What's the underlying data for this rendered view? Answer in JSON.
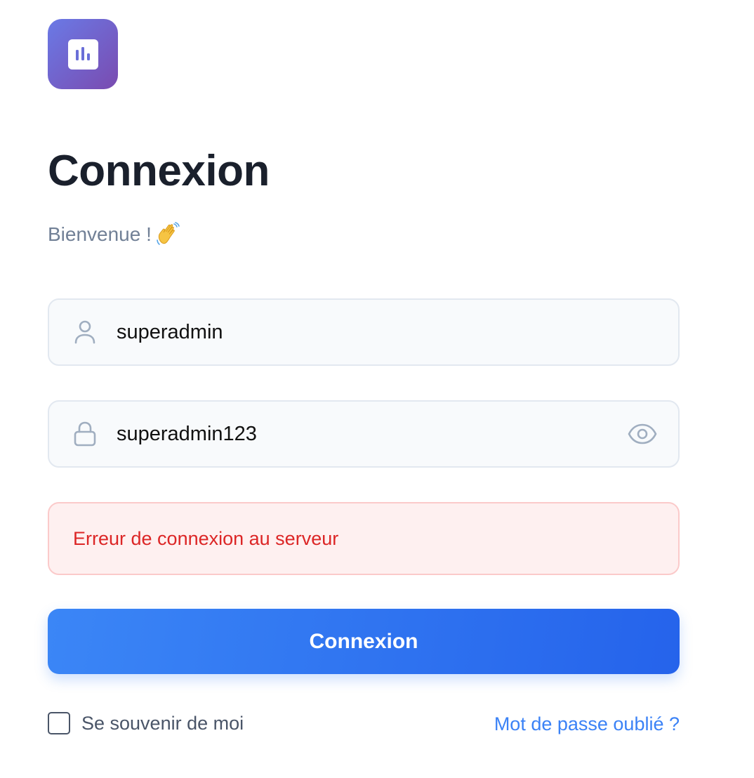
{
  "header": {
    "title": "Connexion",
    "subtitle": "Bienvenue !",
    "subtitle_icon": "waving-hand-icon"
  },
  "form": {
    "username": {
      "value": "superadmin",
      "icon": "user-icon"
    },
    "password": {
      "value": "superadmin123",
      "icon": "lock-icon",
      "toggle_icon": "eye-icon"
    },
    "error_message": "Erreur de connexion au serveur",
    "submit_label": "Connexion",
    "remember_label": "Se souvenir de moi",
    "forgot_label": "Mot de passe oublié ?"
  },
  "colors": {
    "primary": "#3b82f6",
    "error": "#dc2626",
    "logo_gradient_start": "#6a7ae6",
    "logo_gradient_end": "#7a4bb0"
  }
}
